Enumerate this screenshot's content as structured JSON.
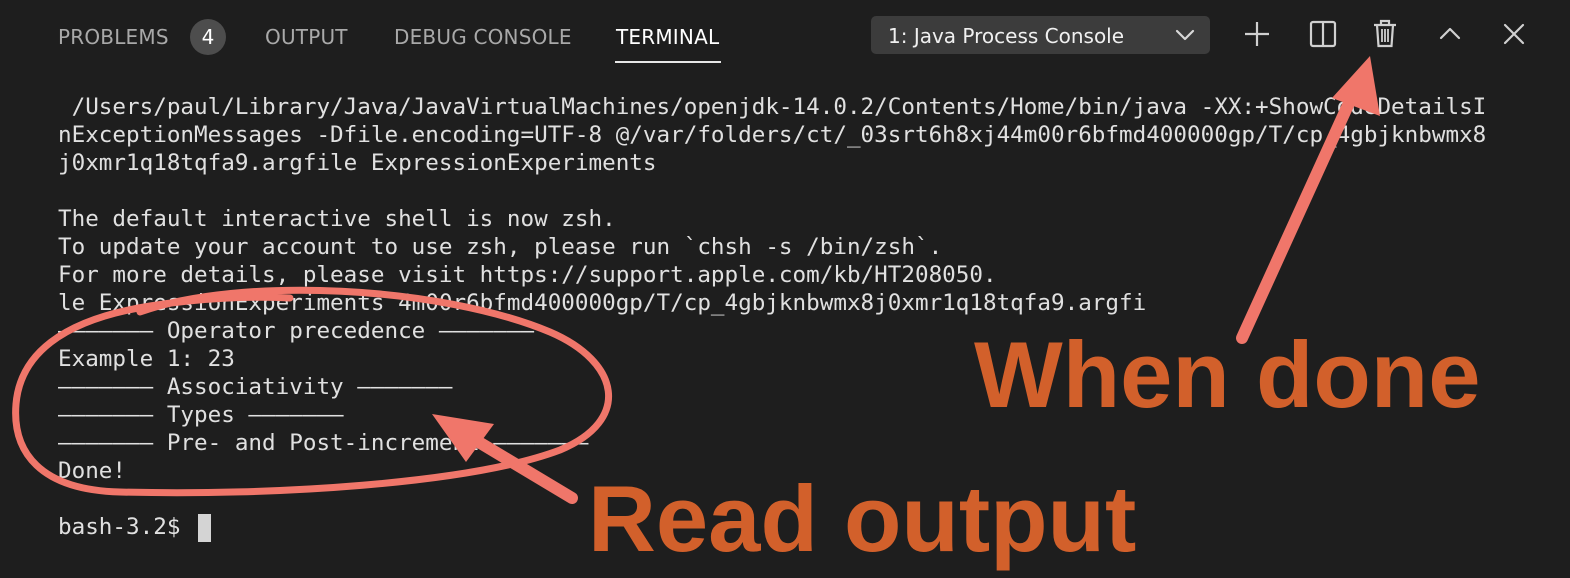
{
  "tabs": {
    "problems": "PROBLEMS",
    "problems_count": "4",
    "output": "OUTPUT",
    "debug_console": "DEBUG CONSOLE",
    "terminal": "TERMINAL"
  },
  "terminal_selector": {
    "selected": "1: Java Process Console"
  },
  "toolbar": {
    "new_icon": "plus-icon",
    "split_icon": "split-icon",
    "kill_icon": "trash-icon",
    "maximize_icon": "chevron-up-icon",
    "close_icon": "close-icon"
  },
  "terminal_lines": [
    " /Users/paul/Library/Java/JavaVirtualMachines/openjdk-14.0.2/Contents/Home/bin/java -XX:+ShowCodeDetailsI",
    "nExceptionMessages -Dfile.encoding=UTF-8 @/var/folders/ct/_03srt6h8xj44m00r6bfmd400000gp/T/cp_4gbjknbwmx8",
    "j0xmr1q18tqfa9.argfile ExpressionExperiments",
    "",
    "The default interactive shell is now zsh.",
    "To update your account to use zsh, please run `chsh -s /bin/zsh`.",
    "For more details, please visit https://support.apple.com/kb/HT208050.",
    "le ExpressionExperiments 4m00r6bfmd400000gp/T/cp_4gbjknbwmx8j0xmr1q18tqfa9.argfi",
    "——————— Operator precedence ———————",
    "Example 1: 23",
    "——————— Associativity ———————",
    "——————— Types ———————",
    "——————— Pre- and Post-increment ———————",
    "Done!",
    "",
    "bash-3.2$ "
  ],
  "annotations": {
    "when_done": "When done",
    "read_output": "Read output",
    "color": "#d2602b",
    "stroke_color": "#f0766a"
  }
}
